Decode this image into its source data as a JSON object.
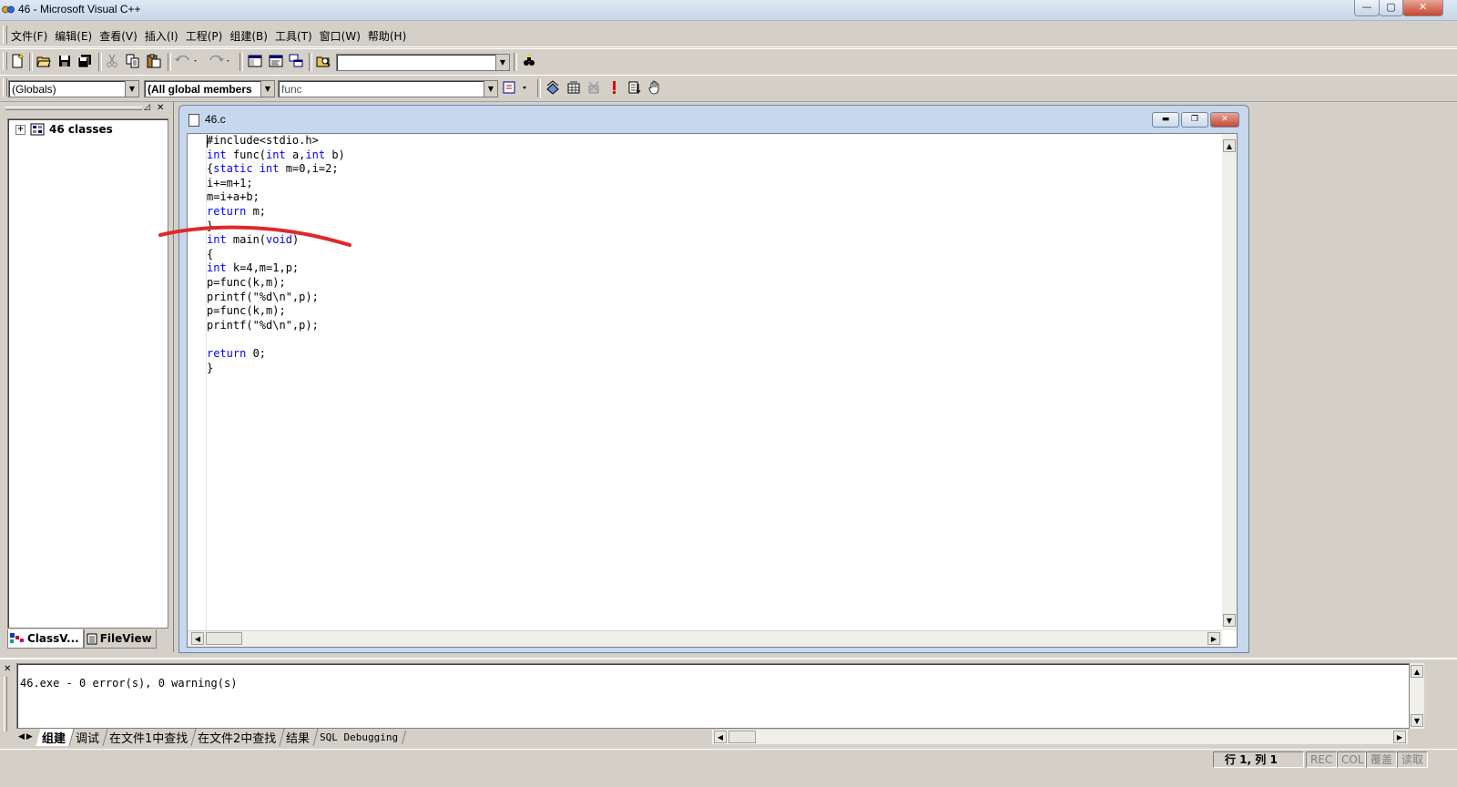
{
  "window": {
    "title": "46 - Microsoft Visual C++",
    "controls": {
      "minimize": "—",
      "maximize": "▢",
      "close": "✕"
    }
  },
  "menu": {
    "items": [
      {
        "label": "文件(F)"
      },
      {
        "label": "编辑(E)"
      },
      {
        "label": "查看(V)"
      },
      {
        "label": "插入(I)"
      },
      {
        "label": "工程(P)"
      },
      {
        "label": "组建(B)"
      },
      {
        "label": "工具(T)"
      },
      {
        "label": "窗口(W)"
      },
      {
        "label": "帮助(H)"
      }
    ]
  },
  "toolbar": {
    "find_combo_value": "",
    "icons": [
      "new-file-icon",
      "open-folder-icon",
      "save-icon",
      "save-all-icon",
      "cut-icon",
      "copy-icon",
      "paste-icon",
      "undo-icon",
      "redo-icon",
      "workspace-icon",
      "output-icon",
      "window-list-icon",
      "find-in-files-icon",
      "find-icon"
    ]
  },
  "wizardbar": {
    "scope_combo": "(Globals)",
    "members_combo": "(All global members",
    "function_combo": "func",
    "icons": [
      "wizard-action-icon",
      "compile-icon",
      "build-icon",
      "stop-build-icon",
      "execute-icon",
      "go-icon",
      "breakpoint-hand-icon"
    ]
  },
  "classview": {
    "root_label": "46 classes",
    "tabs": [
      {
        "label": "ClassV...",
        "active": true
      },
      {
        "label": "FileView",
        "active": false
      }
    ]
  },
  "editor": {
    "doc_title": "46.c",
    "controls": {
      "minimize": "▬",
      "maximize": "❐",
      "close": "✕"
    }
  },
  "output": {
    "message": "46.exe - 0 error(s), 0 warning(s)",
    "tabs": [
      {
        "label": "组建",
        "active": true
      },
      {
        "label": "调试",
        "active": false
      },
      {
        "label": "在文件1中查找",
        "active": false
      },
      {
        "label": "在文件2中查找",
        "active": false
      },
      {
        "label": "结果",
        "active": false
      },
      {
        "label": "SQL Debugging",
        "active": false
      }
    ]
  },
  "statusbar": {
    "position": "行 1, 列 1",
    "rec": "REC",
    "col": "COL",
    "ovr": "覆盖",
    "read": "读取"
  },
  "colors": {
    "keyword": "#0000ff",
    "annotation_stroke": "#e0282b",
    "chrome": "#d4d0c8"
  }
}
